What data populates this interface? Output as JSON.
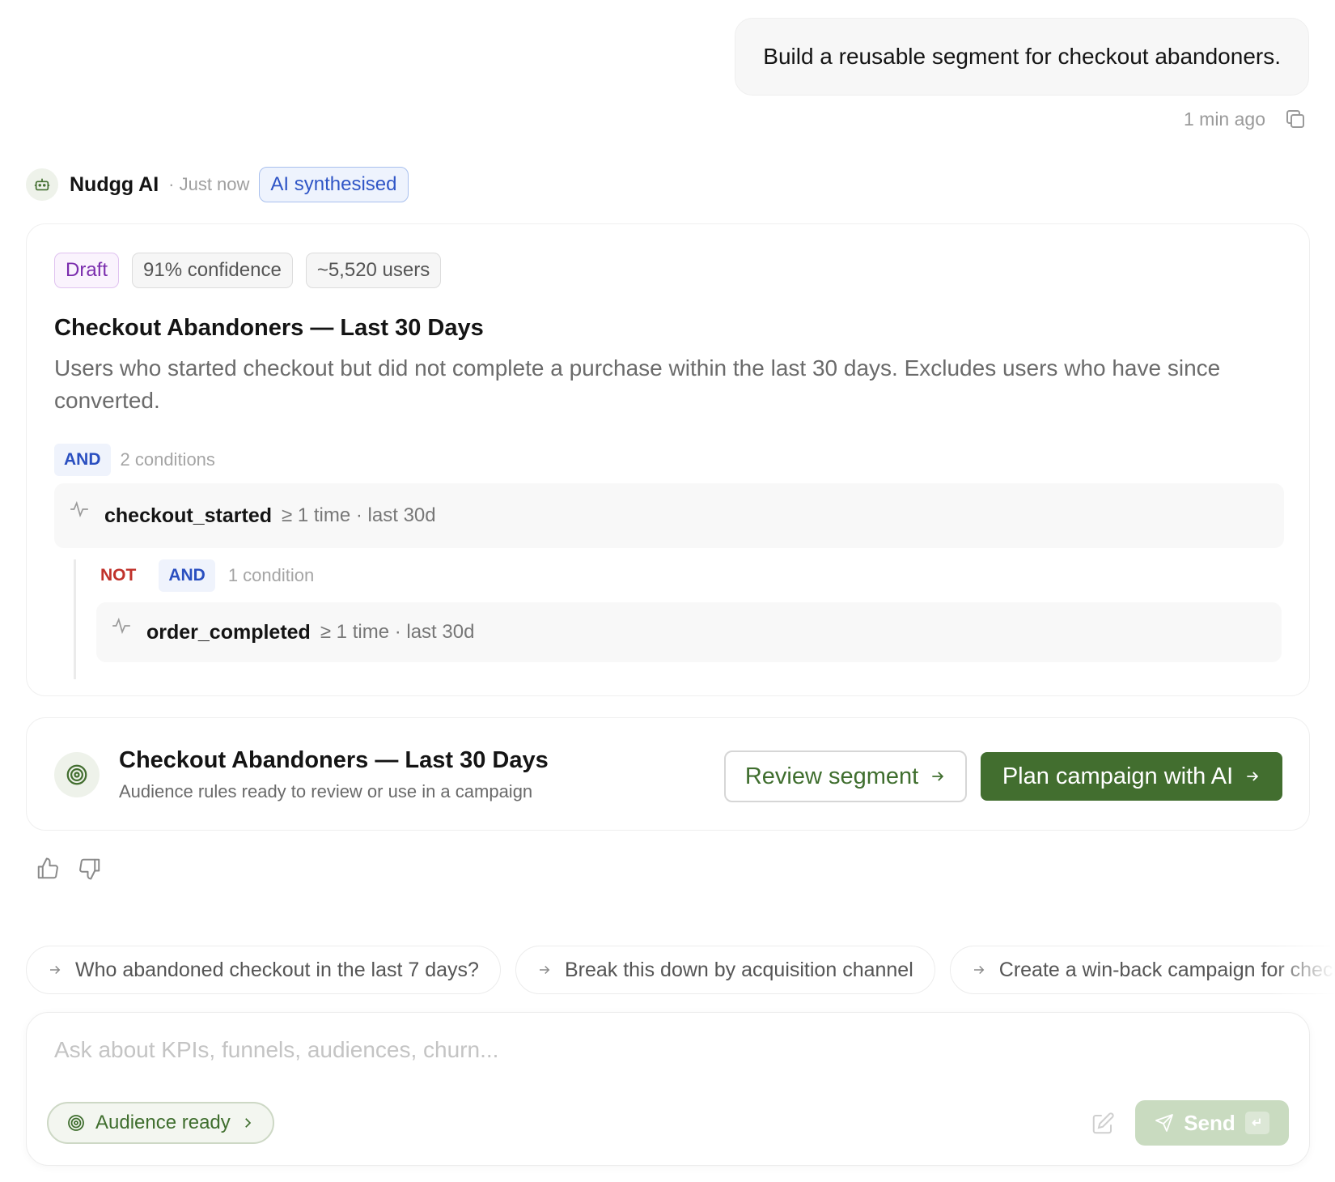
{
  "user_message": {
    "text": "Build a reusable segment for checkout abandoners.",
    "time": "1 min ago"
  },
  "ai": {
    "name": "Nudgg AI",
    "time": "· Just now",
    "badge": "AI synthesised"
  },
  "segment": {
    "pills": [
      "Draft",
      "91% confidence",
      "~5,520 users"
    ],
    "title": "Checkout Abandoners — Last 30 Days",
    "description": "Users who started checkout but did not complete a purchase within the last 30 days. Excludes users who have since converted.",
    "root_operator": "AND",
    "root_count": "2 conditions",
    "conditions": [
      {
        "event": "checkout_started",
        "rule": "≥ 1 time · last 30d"
      }
    ],
    "nested": {
      "negation": "NOT",
      "operator": "AND",
      "count": "1 condition",
      "conditions": [
        {
          "event": "order_completed",
          "rule": "≥ 1 time · last 30d"
        }
      ]
    }
  },
  "audience_card": {
    "title": "Checkout Abandoners — Last 30 Days",
    "subtitle": "Audience rules ready to review or use in a campaign",
    "review_label": "Review segment",
    "plan_label": "Plan campaign with AI"
  },
  "suggestions": [
    "Who abandoned checkout in the last 7 days?",
    "Break this down by acquisition channel",
    "Create a win-back campaign for checkout abandoners"
  ],
  "composer": {
    "placeholder": "Ask about KPIs, funnels, audiences, churn...",
    "chip_label": "Audience ready",
    "send_label": "Send",
    "enter_glyph": "↵"
  },
  "colors": {
    "brand_green": "#426e2f",
    "ai_blue": "#2f55c6",
    "draft_purple": "#7a2cad",
    "not_red": "#c0322b"
  }
}
